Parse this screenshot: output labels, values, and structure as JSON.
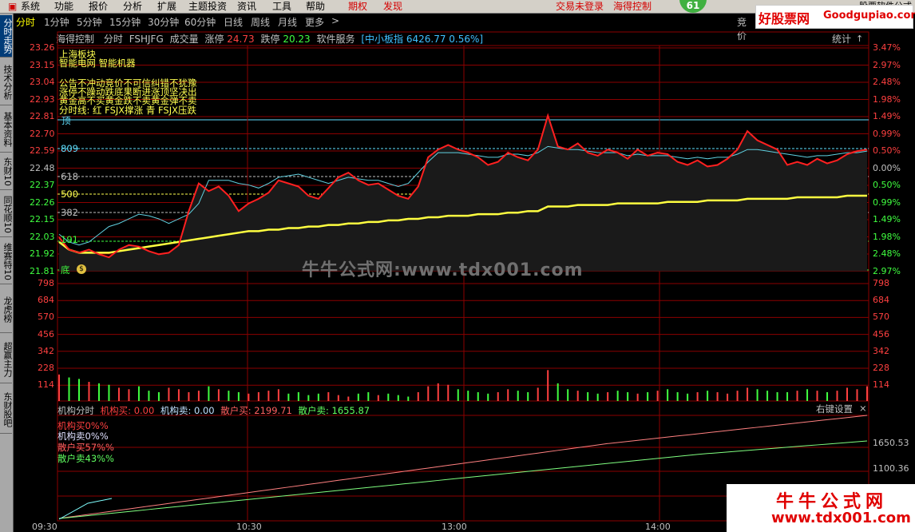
{
  "menu": {
    "items": [
      "系统",
      "功能",
      "报价",
      "分析",
      "扩展",
      "主题投资",
      "资讯",
      "工具",
      "帮助"
    ],
    "period_btn": "期权",
    "discover_btn": "发现",
    "trade_login": "交易未登录",
    "brand": "海得控制",
    "badge": "61",
    "app_name": "股票软件公式"
  },
  "sidebar": {
    "tabs": [
      "分时走势",
      "技术分析",
      "基本资料",
      "东财10",
      "同花顺10",
      "维赛特10",
      "龙虎榜",
      "超赢主力",
      "东财股吧"
    ]
  },
  "periods": {
    "items": [
      "分时",
      "1分钟",
      "5分钟",
      "15分钟",
      "30分钟",
      "60分钟",
      "日线",
      "周线",
      "月线",
      "更多"
    ],
    "more_arrow": ">",
    "right_label": "竞价"
  },
  "logo": {
    "text1": "好股票网",
    "text2": "Goodgupiao.com"
  },
  "info": {
    "name": "海得控制",
    "mode": "分时",
    "formula": "FSHJFG",
    "vol_label": "成交量",
    "limit_up_label": "涨停",
    "limit_up": "24.73",
    "limit_down_label": "跌停",
    "limit_down": "20.23",
    "sector": "软件服务",
    "index": "[中小板指 6426.77 0.56%]",
    "stats": "统计",
    "stats_arrow": "↑"
  },
  "annotations": {
    "sector_title": "上海板块",
    "concepts": "智能电网 智能机器",
    "line1": "公告不冲动竞价不可信纠错不犹豫",
    "line2": "涨停不躁动跌底果断进涨顶坚决出",
    "line3": "黄金高不买黄金跌不卖黄金弹不卖",
    "line4": "分时线: 红 FSJX撑涨 青 FSJX压跌",
    "top_mark": "顶",
    "bottom_mark": "底",
    "level_809": "809",
    "level_618": "618",
    "level_500": "500",
    "level_382": "382",
    "level_191": "191"
  },
  "price_axis": [
    "23.26",
    "23.15",
    "23.04",
    "22.93",
    "22.81",
    "22.70",
    "22.59",
    "22.48",
    "22.37",
    "22.26",
    "22.15",
    "22.03",
    "21.92",
    "21.81"
  ],
  "pct_axis": [
    "3.47%",
    "2.97%",
    "2.48%",
    "1.98%",
    "1.49%",
    "0.99%",
    "0.50%",
    "0.00%",
    "0.50%",
    "0.99%",
    "1.49%",
    "1.98%",
    "2.48%",
    "2.97%"
  ],
  "vol_axis": [
    "798",
    "684",
    "570",
    "456",
    "342",
    "228",
    "114"
  ],
  "bottom_panel": {
    "title": "机构分时",
    "inst_buy_label": "机构买:",
    "inst_buy": "0.00",
    "inst_sell_label": "机构卖:",
    "inst_sell": "0.00",
    "retail_buy_label": "散户买:",
    "retail_buy": "2199.71",
    "retail_sell_label": "散户卖:",
    "retail_sell": "1655.87",
    "settings": "右键设置",
    "close": "×",
    "leg1": "机构买0%%",
    "leg2": "机构卖0%%",
    "leg3": "散户买57%%",
    "leg4": "散户卖43%%",
    "axis1": "1650.53",
    "axis2": "1100.36"
  },
  "time_axis": [
    "09:30",
    "10:30",
    "13:00",
    "14:00"
  ],
  "watermarks": {
    "center": "牛牛公式网:www.tdx001.com",
    "corner1": "牛牛公式网",
    "corner2": "www.tdx001.com"
  },
  "chart_data": {
    "type": "line",
    "title": "",
    "ylim": [
      21.81,
      23.26
    ],
    "series": [
      {
        "name": "",
        "values": [
          22.03,
          21.95,
          21.93,
          21.95,
          21.92,
          21.9,
          21.95,
          21.98,
          21.97,
          21.94,
          21.92,
          21.93,
          21.98,
          22.2,
          22.38,
          22.33,
          22.36,
          22.3,
          22.2,
          22.25,
          22.28,
          22.32,
          22.4,
          22.38,
          22.36,
          22.3,
          22.28,
          22.35,
          22.42,
          22.45,
          22.4,
          22.37,
          22.38,
          22.34,
          22.3,
          22.28,
          22.36,
          22.55,
          22.6,
          22.63,
          22.6,
          22.58,
          22.55,
          22.5,
          22.52,
          22.58,
          22.55,
          22.53,
          22.6,
          22.82,
          22.62,
          22.6,
          22.64,
          22.58,
          22.56,
          22.6,
          22.58,
          22.54,
          22.6,
          22.56,
          22.58,
          22.57,
          22.52,
          22.5,
          22.53,
          22.49,
          22.5,
          22.54,
          22.6,
          22.72,
          22.66,
          22.63,
          22.6,
          22.5,
          22.52,
          22.5,
          22.54,
          22.51,
          22.53,
          22.57,
          22.59,
          22.6
        ]
      },
      {
        "name": "",
        "values": [
          22.0,
          21.95,
          21.93,
          21.93,
          21.93,
          21.93,
          21.94,
          21.95,
          21.96,
          21.97,
          21.98,
          21.99,
          22.0,
          22.01,
          22.02,
          22.03,
          22.04,
          22.05,
          22.06,
          22.07,
          22.07,
          22.08,
          22.08,
          22.09,
          22.09,
          22.1,
          22.1,
          22.11,
          22.11,
          22.12,
          22.12,
          22.13,
          22.13,
          22.14,
          22.14,
          22.15,
          22.15,
          22.16,
          22.16,
          22.17,
          22.17,
          22.17,
          22.18,
          22.18,
          22.18,
          22.19,
          22.19,
          22.2,
          22.2,
          22.23,
          22.23,
          22.23,
          22.24,
          22.24,
          22.24,
          22.24,
          22.25,
          22.25,
          22.25,
          22.25,
          22.25,
          22.26,
          22.26,
          22.26,
          22.26,
          22.27,
          22.27,
          22.27,
          22.27,
          22.28,
          22.28,
          22.28,
          22.28,
          22.28,
          22.29,
          22.29,
          22.29,
          22.29,
          22.29,
          22.3,
          22.3,
          22.3
        ]
      },
      {
        "name": "",
        "values": [
          22.05,
          22.0,
          21.98,
          22.0,
          22.05,
          22.1,
          22.12,
          22.15,
          22.18,
          22.17,
          22.15,
          22.12,
          22.15,
          22.18,
          22.25,
          22.4,
          22.4,
          22.4,
          22.38,
          22.37,
          22.35,
          22.38,
          22.42,
          22.43,
          22.44,
          22.42,
          22.4,
          22.38,
          22.4,
          22.42,
          22.41,
          22.4,
          22.4,
          22.38,
          22.36,
          22.38,
          22.45,
          22.52,
          22.58,
          22.58,
          22.58,
          22.57,
          22.56,
          22.55,
          22.55,
          22.57,
          22.57,
          22.56,
          22.58,
          22.62,
          22.61,
          22.6,
          22.6,
          22.59,
          22.58,
          22.58,
          22.58,
          22.56,
          22.57,
          22.56,
          22.56,
          22.56,
          22.55,
          22.54,
          22.55,
          22.54,
          22.55,
          22.55,
          22.57,
          22.6,
          22.6,
          22.59,
          22.58,
          22.57,
          22.56,
          22.55,
          22.56,
          22.56,
          22.57,
          22.58,
          22.58,
          22.59
        ]
      }
    ],
    "volume": [
      180,
      160,
      150,
      130,
      120,
      110,
      90,
      80,
      100,
      70,
      60,
      90,
      80,
      60,
      70,
      100,
      80,
      70,
      60,
      50,
      60,
      70,
      80,
      50,
      60,
      40,
      50,
      60,
      40,
      30,
      50,
      60,
      40,
      50,
      40,
      30,
      60,
      100,
      120,
      110,
      80,
      70,
      60,
      50,
      60,
      80,
      70,
      60,
      90,
      210,
      120,
      80,
      70,
      60,
      50,
      60,
      70,
      60,
      50,
      60,
      70,
      80,
      60,
      50,
      60,
      70,
      60,
      50,
      70,
      90,
      80,
      70,
      60,
      60,
      70,
      80,
      70,
      60,
      70,
      90,
      80,
      100
    ]
  }
}
